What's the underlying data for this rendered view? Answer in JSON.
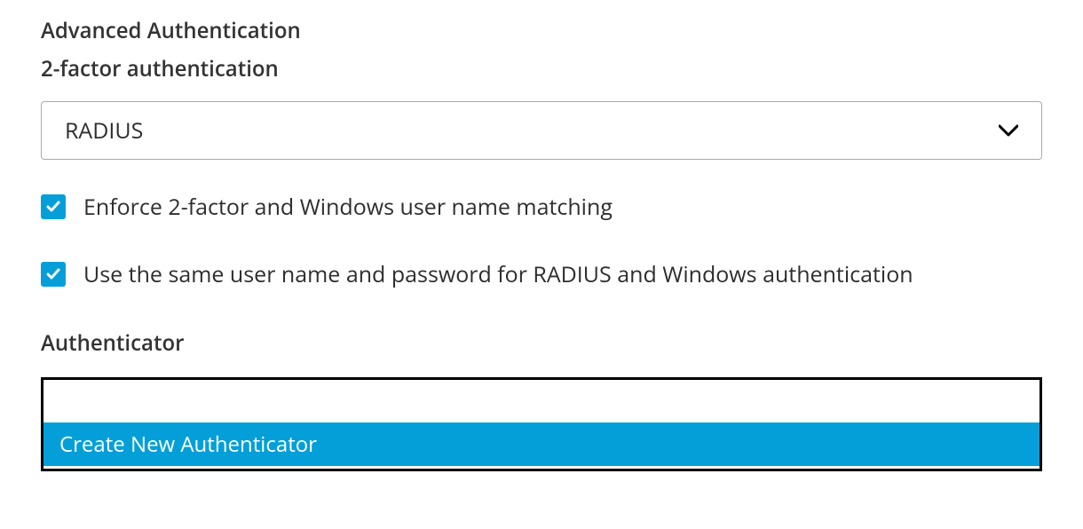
{
  "headings": {
    "main": "Advanced Authentication",
    "subtitle": "2-factor authentication",
    "authenticator": "Authenticator"
  },
  "two_factor_select": {
    "value": "RADIUS"
  },
  "checkboxes": {
    "enforce_matching": {
      "checked": true,
      "label": "Enforce 2-factor and Windows user name matching"
    },
    "same_credentials": {
      "checked": true,
      "label": "Use the same user name and password for RADIUS and Windows authentication"
    }
  },
  "authenticator_dropdown": {
    "highlighted_option": "Create New Authenticator"
  },
  "colors": {
    "accent": "#049fd9",
    "text": "#333333",
    "border": "#a9a9a9"
  }
}
